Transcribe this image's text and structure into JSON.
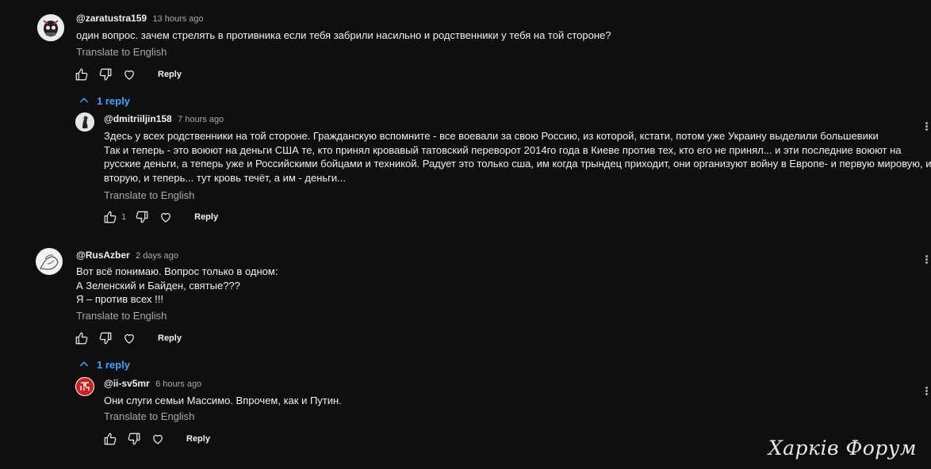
{
  "comments": [
    {
      "author": "@zaratustra159",
      "time": "13 hours ago",
      "lines": [
        "один вопрос. зачем стрелять в противника если тебя забрили насильно и родственники у тебя на той стороне?"
      ],
      "translate": "Translate to English",
      "likes": "",
      "reply": "Reply",
      "replies": "1 reply"
    },
    {
      "author": "@dmitriiljin158",
      "time": "7 hours ago",
      "lines": [
        "Здесь у всех родственники на той стороне. Гражданскую вспомните - все воевали за свою Россию, из которой, кстати, потом уже Украину выделили большевики",
        "Так и теперь - это воюют на деньги США те, кто принял кровавый татовский переворот 2014го года в Киеве против тех, кто его не принял... и эти последние воюют на",
        "русские деньги, а теперь уже и Российскими бойцами и техникой. Радует это только сша, им когда трындец приходит, они организуют войну в Европе- и первую мировую, и",
        "вторую, и теперь... тут кровь течёт, а им - деньги..."
      ],
      "translate": "Translate to English",
      "likes": "1",
      "reply": "Reply"
    },
    {
      "author": "@RusAzber",
      "time": "2 days ago",
      "lines": [
        "Вот всё понимаю. Вопрос только в одном:",
        "А Зеленский и Байден, святые???",
        "Я – против всех !!!"
      ],
      "translate": "Translate to English",
      "likes": "",
      "reply": "Reply",
      "replies": "1 reply"
    },
    {
      "author": "@ii-sv5mr",
      "time": "6 hours ago",
      "lines": [
        "Они слуги семьи Массимо. Впрочем, как и Путин."
      ],
      "translate": "Translate to English",
      "likes": "",
      "reply": "Reply"
    }
  ],
  "watermark": "Харків Форум",
  "icons": {
    "like": "thumb-up-icon",
    "dislike": "thumb-down-icon",
    "heart": "heart-icon",
    "collapse": "chevron-up-icon",
    "menu": "more-vert-icon"
  },
  "colors": {
    "background": "#0f0f0f",
    "link": "#3ea6ff",
    "muted": "#aaaaaa"
  }
}
